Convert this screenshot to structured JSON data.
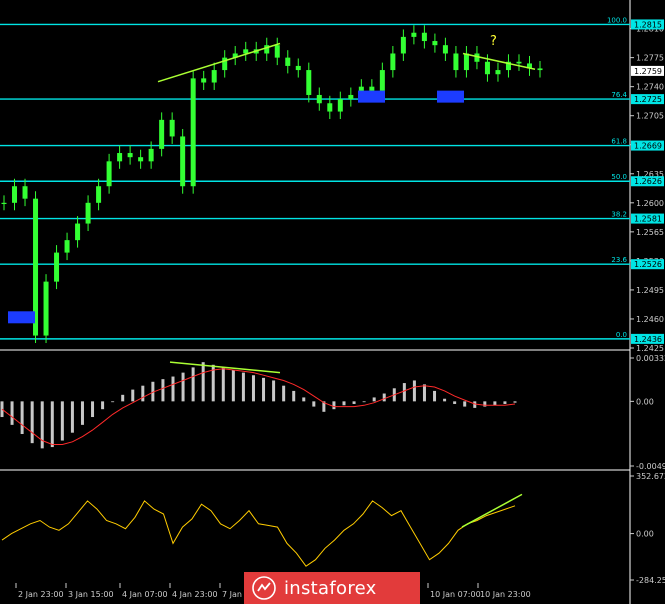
{
  "chart_data": [
    {
      "type": "candlestick",
      "panel": "price",
      "ylim": [
        1.2425,
        1.283
      ],
      "price_ticks": [
        "1.2810",
        "1.2775",
        "1.2740",
        "1.2705",
        "1.2670",
        "1.2635",
        "1.2600",
        "1.2565",
        "1.2530",
        "1.2495",
        "1.2460",
        "1.2425"
      ],
      "current_price": "1.2759",
      "fib_levels": [
        {
          "label": "100.0",
          "value": 1.2815,
          "text": "1.2815"
        },
        {
          "label": "76.4",
          "value": 1.2725,
          "text": "1.2725"
        },
        {
          "label": "61.8",
          "value": 1.2669,
          "text": "1.2669"
        },
        {
          "label": "50.0",
          "value": 1.2626,
          "text": "1.2626"
        },
        {
          "label": "38.2",
          "value": 1.2581,
          "text": "1.2581"
        },
        {
          "label": "23.6",
          "value": 1.2526,
          "text": "1.2526"
        },
        {
          "label": "0.0",
          "value": 1.2436,
          "text": "1.2436"
        }
      ],
      "close_series": [
        1.26,
        1.262,
        1.2605,
        1.244,
        1.2505,
        1.254,
        1.2555,
        1.2575,
        1.26,
        1.262,
        1.265,
        1.266,
        1.2655,
        1.265,
        1.2665,
        1.27,
        1.268,
        1.262,
        1.275,
        1.2745,
        1.276,
        1.2775,
        1.278,
        1.2785,
        1.278,
        1.279,
        1.2775,
        1.2765,
        1.276,
        1.273,
        1.272,
        1.271,
        1.2725,
        1.273,
        1.274,
        1.2735,
        1.276,
        1.278,
        1.28,
        1.2805,
        1.2795,
        1.279,
        1.278,
        1.276,
        1.278,
        1.277,
        1.2755,
        1.276,
        1.277,
        1.2768,
        1.2762,
        1.276
      ],
      "annotations": {
        "question_mark": "?"
      }
    },
    {
      "type": "histogram",
      "panel": "macd",
      "ticks": [
        "0.00332",
        "0.00",
        "-0.00495"
      ],
      "ylim": [
        -0.00495,
        0.00332
      ],
      "values": [
        -0.0012,
        -0.0018,
        -0.0025,
        -0.0032,
        -0.0036,
        -0.0035,
        -0.003,
        -0.0024,
        -0.0018,
        -0.0012,
        -0.0006,
        0.0,
        0.0005,
        0.0009,
        0.0012,
        0.0015,
        0.0017,
        0.0019,
        0.0022,
        0.0026,
        0.003,
        0.0028,
        0.0026,
        0.0024,
        0.0022,
        0.002,
        0.0018,
        0.0016,
        0.0012,
        0.0008,
        0.0003,
        -0.0004,
        -0.0008,
        -0.0006,
        -0.0003,
        -0.0002,
        0.0,
        0.0003,
        0.0006,
        0.001,
        0.0014,
        0.0016,
        0.0013,
        0.0008,
        0.0002,
        -0.0002,
        -0.0004,
        -0.0005,
        -0.0004,
        -0.0003,
        -0.0002,
        -0.0001
      ],
      "signal": [
        -0.0006,
        -0.0012,
        -0.0018,
        -0.0024,
        -0.003,
        -0.0033,
        -0.0033,
        -0.0031,
        -0.0027,
        -0.0022,
        -0.0016,
        -0.001,
        -0.0005,
        -0.0001,
        0.0003,
        0.0007,
        0.001,
        0.0013,
        0.0016,
        0.0019,
        0.0022,
        0.0024,
        0.0025,
        0.0024,
        0.0023,
        0.0022,
        0.002,
        0.0018,
        0.0016,
        0.0013,
        0.0009,
        0.0004,
        -0.0001,
        -0.0004,
        -0.0004,
        -0.0004,
        -0.0003,
        -0.0001,
        0.0002,
        0.0005,
        0.0008,
        0.0011,
        0.0012,
        0.0011,
        0.0008,
        0.0004,
        0.0001,
        -0.0002,
        -0.0003,
        -0.0003,
        -0.0003,
        -0.0002
      ]
    },
    {
      "type": "line",
      "panel": "cci",
      "ticks": [
        "352.6724",
        "0.00",
        "-284.251"
      ],
      "ylim": [
        -284.251,
        352.6724
      ],
      "values": [
        -40,
        0,
        30,
        60,
        80,
        40,
        20,
        60,
        130,
        200,
        150,
        80,
        60,
        30,
        100,
        200,
        150,
        120,
        -60,
        40,
        90,
        180,
        140,
        60,
        30,
        80,
        140,
        60,
        50,
        40,
        -60,
        -120,
        -200,
        -160,
        -90,
        -40,
        20,
        60,
        120,
        200,
        160,
        110,
        140,
        40,
        -60,
        -160,
        -120,
        -60,
        20,
        60,
        80,
        110,
        130,
        150,
        170
      ],
      "x_ticks": [
        "2 Jan 23:00",
        "3 Jan 15:00",
        "4 Jan 07:00",
        "4 Jan 23:00",
        "7 Jan",
        "10 Jan 07:00",
        "10 Jan 23:00"
      ]
    }
  ],
  "colors": {
    "background": "#000000",
    "candle": "#33ff33",
    "fib_line": "#00e5e5",
    "fib_text": "#00e5e5",
    "price_label_box": "#00e5e5",
    "current_price_box": "#ffffff",
    "trend_line": "#aaff33",
    "question_mark": "#ffff33",
    "support_box": "#1c3cff",
    "macd_bar": "#c8c8c8",
    "macd_signal": "#ff2a2a",
    "macd_trend": "#aaff33",
    "cci_line": "#ffcc00",
    "cci_trend": "#aaff33",
    "axis_text": "#cccccc",
    "grid_sep": "#ffffff",
    "logo_bg": "#e23b3b"
  },
  "watermark": {
    "brand": "instaforex"
  }
}
